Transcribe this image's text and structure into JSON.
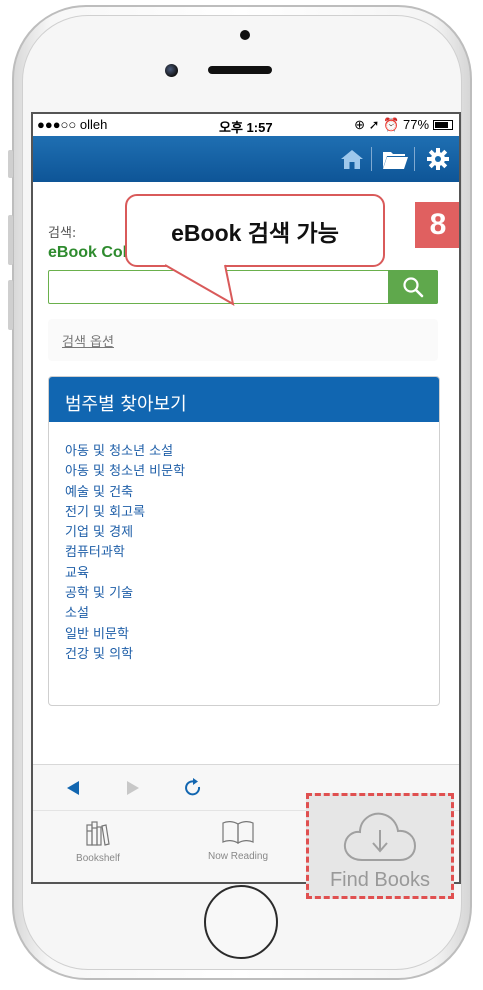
{
  "status_bar": {
    "carrier": "●●●○○ olleh",
    "time": "오후 1:57",
    "right_status": "⊕ ➚ ⏰ 77%",
    "battery_level": 0.77
  },
  "topbar": {
    "icons": [
      "home-icon",
      "folder-icon",
      "gear-icon"
    ]
  },
  "search": {
    "label": "검색:",
    "collection": "eBook Collection (EBSCOhost)",
    "value": "",
    "options_link": "검색 옵션"
  },
  "callout": {
    "text": "eBook 검색 가능",
    "badge": "8"
  },
  "browse": {
    "title": "범주별 찾아보기",
    "items": [
      "아동 및 청소년 소설",
      "아동 및 청소년 비문학",
      "예술 및 건축",
      "전기 및 회고록",
      "기업 및 경제",
      "컴퓨터과학",
      "교육",
      "공학 및 기술",
      "소설",
      "일반 비문학",
      "건강 및 의학"
    ]
  },
  "navbar": {
    "icons": [
      "back-arrow-icon",
      "forward-arrow-icon",
      "reload-icon"
    ]
  },
  "tabs": [
    {
      "label": "Bookshelf",
      "icon": "bookshelf-icon"
    },
    {
      "label": "Now Reading",
      "icon": "open-book-icon"
    },
    {
      "label": "Find Books",
      "icon": "cloud-download-icon"
    }
  ],
  "colors": {
    "header_blue": "#1166b1",
    "accent_green": "#5fa84c",
    "highlight_red": "#e05050"
  }
}
